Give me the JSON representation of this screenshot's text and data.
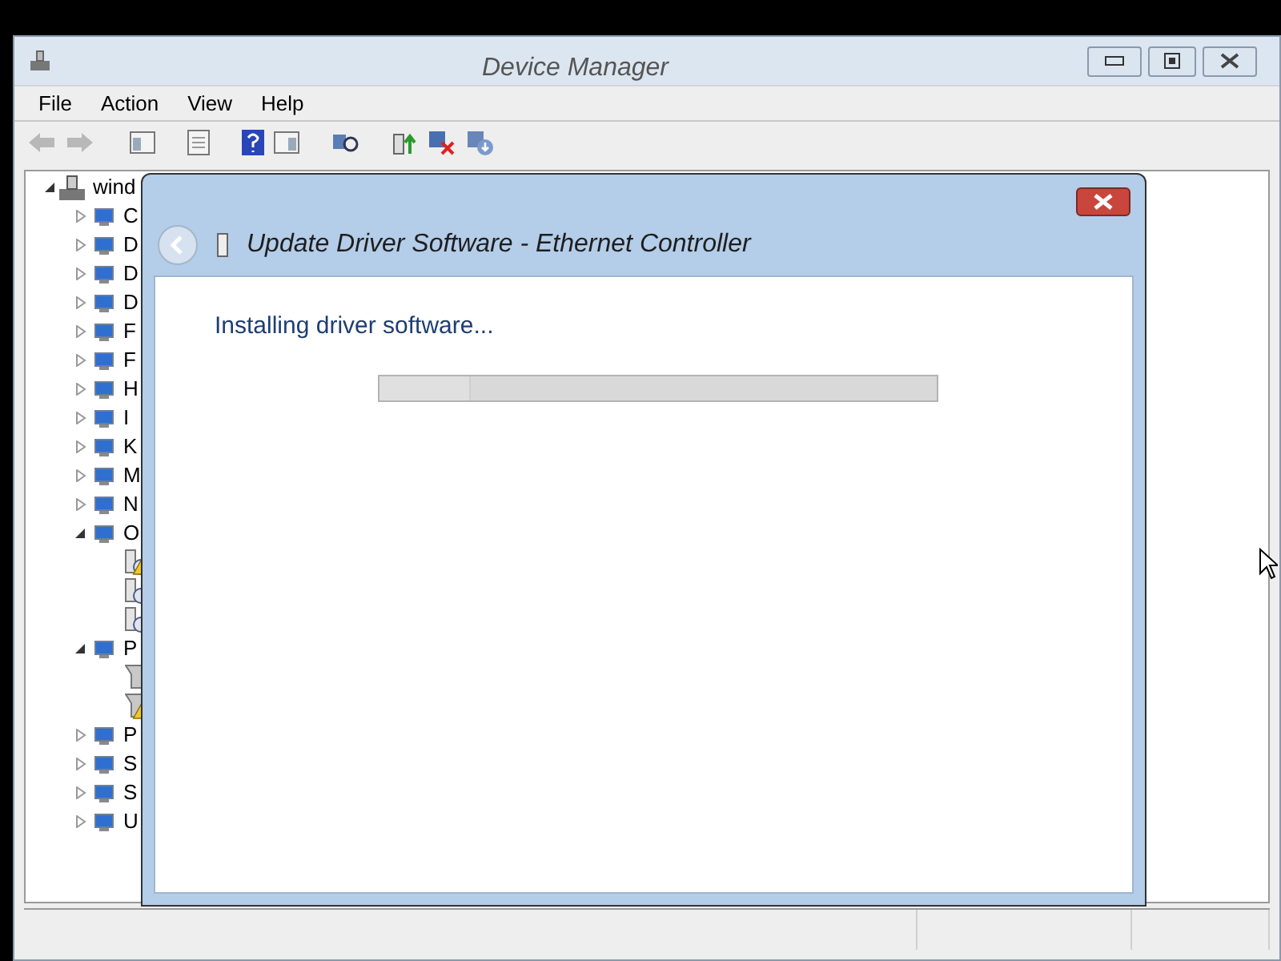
{
  "window": {
    "title": "Device Manager"
  },
  "menu": [
    "File",
    "Action",
    "View",
    "Help"
  ],
  "toolbar": {
    "back_disabled": true,
    "forward_disabled": true
  },
  "tree": {
    "label": "wind",
    "expanded": true,
    "children": [
      {
        "label": "C",
        "expanded": false
      },
      {
        "label": "D",
        "expanded": false
      },
      {
        "label": "D",
        "expanded": false
      },
      {
        "label": "D",
        "expanded": false
      },
      {
        "label": "F",
        "expanded": false
      },
      {
        "label": "F",
        "expanded": false
      },
      {
        "label": "H",
        "expanded": false
      },
      {
        "label": "I",
        "expanded": false
      },
      {
        "label": "K",
        "expanded": false
      },
      {
        "label": "M",
        "expanded": false
      },
      {
        "label": "N",
        "expanded": false
      },
      {
        "label": "O",
        "expanded": true,
        "children": [
          {
            "kind": "unknown",
            "warning": true
          },
          {
            "kind": "unknown",
            "warning": false
          },
          {
            "kind": "unknown",
            "warning": false
          }
        ]
      },
      {
        "label": "P",
        "expanded": true,
        "children": [
          {
            "kind": "port",
            "warning": false
          },
          {
            "kind": "port",
            "warning": true
          }
        ]
      },
      {
        "label": "P",
        "expanded": false
      },
      {
        "label": "S",
        "expanded": false
      },
      {
        "label": "S",
        "expanded": false
      },
      {
        "label": "U",
        "expanded": false
      }
    ]
  },
  "dialog": {
    "title": "Update Driver Software - Ethernet Controller",
    "message": "Installing driver software...",
    "progress": {
      "indeterminate": true
    }
  }
}
